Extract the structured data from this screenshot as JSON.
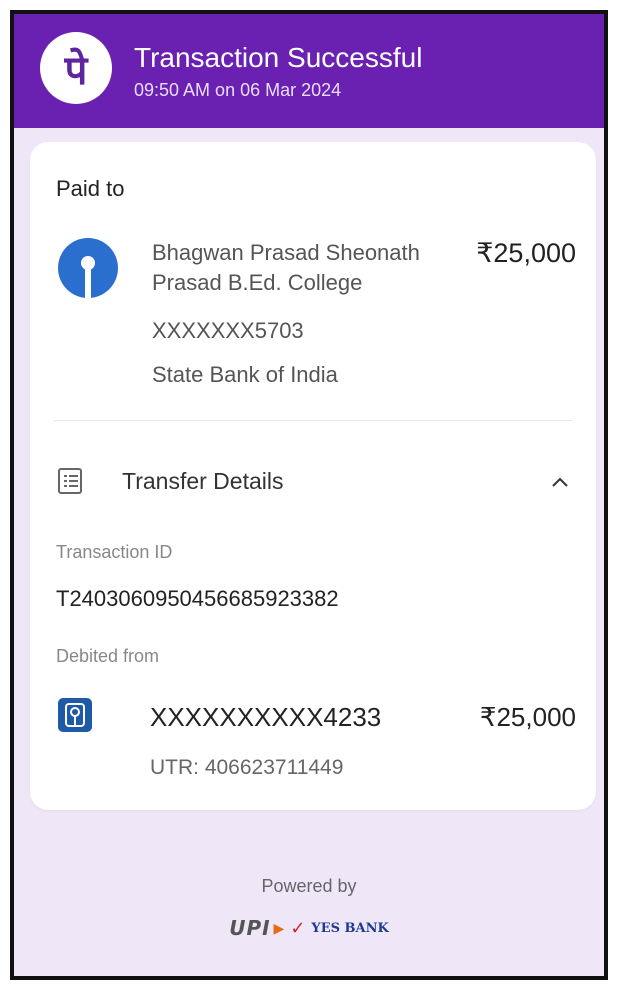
{
  "header": {
    "logo_glyph": "पे",
    "title": "Transaction Successful",
    "subtitle": "09:50 AM on 06 Mar 2024",
    "color": "#6a21b2"
  },
  "paid_to": {
    "label": "Paid to",
    "name": "Bhagwan Prasad Sheonath Prasad B.Ed. College",
    "amount": "₹25,000",
    "account": "XXXXXXX5703",
    "bank": "State Bank of India",
    "icon": "sbi-logo-icon"
  },
  "transfer_details": {
    "title": "Transfer Details",
    "icon": "receipt-icon",
    "expanded": true,
    "transaction_id_label": "Transaction ID",
    "transaction_id": "T2403060950456685923382",
    "debited_label": "Debited from",
    "debited_account": "XXXXXXXXXX4233",
    "debited_amount": "₹25,000",
    "utr": "UTR: 406623711449"
  },
  "footer": {
    "powered_by": "Powered by",
    "upi_logo_text": "UPI",
    "bank_logo_text": "YES BANK"
  }
}
